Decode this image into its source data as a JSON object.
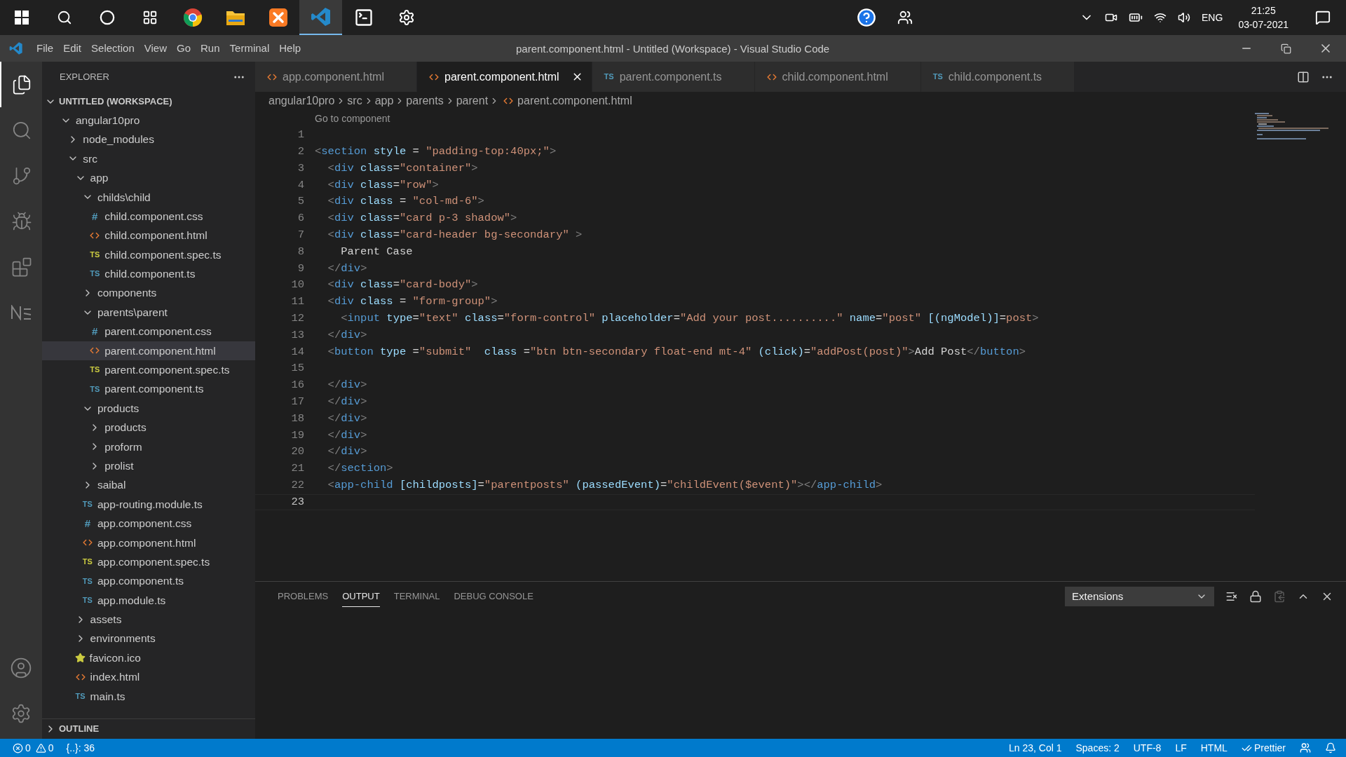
{
  "taskbar": {
    "apps": [
      {
        "kind": "start",
        "selected": false
      },
      {
        "kind": "search",
        "selected": false
      },
      {
        "kind": "circle",
        "selected": false
      },
      {
        "kind": "taskview",
        "selected": false
      },
      {
        "kind": "browser",
        "selected": false
      },
      {
        "kind": "folder",
        "selected": false
      },
      {
        "kind": "xampp",
        "selected": false
      },
      {
        "kind": "editor",
        "selected": true
      },
      {
        "kind": "terminal",
        "selected": false
      },
      {
        "kind": "settings",
        "selected": false
      }
    ],
    "language": "ENG",
    "time": "21:25",
    "date": "03-07-2021"
  },
  "menu": [
    "File",
    "Edit",
    "Selection",
    "View",
    "Go",
    "Run",
    "Terminal",
    "Help"
  ],
  "window": {
    "title": "parent.component.html - Untitled (Workspace) - Visual Studio Code"
  },
  "activity": [
    {
      "kind": "files",
      "selected": true
    },
    {
      "kind": "search",
      "selected": false
    },
    {
      "kind": "git",
      "selected": false
    },
    {
      "kind": "debug",
      "selected": false
    },
    {
      "kind": "extensions",
      "selected": false
    },
    {
      "kind": "notebook",
      "selected": false
    }
  ],
  "explorer": {
    "title": "EXPLORER",
    "workspace": {
      "label": "UNTITLED (WORKSPACE)",
      "expanded": true
    },
    "outline": {
      "label": "OUTLINE",
      "expanded": false
    },
    "tree": [
      {
        "label": "angular10pro",
        "kind": "folder",
        "expanded": true,
        "selected": false,
        "children": [
          {
            "label": "node_modules",
            "kind": "folder",
            "expanded": false,
            "selected": false
          },
          {
            "label": "src",
            "kind": "folder",
            "expanded": true,
            "selected": false,
            "children": [
              {
                "label": "app",
                "kind": "folder",
                "expanded": true,
                "selected": false,
                "children": [
                  {
                    "label": "childs\\child",
                    "kind": "folder",
                    "expanded": true,
                    "selected": false,
                    "children": [
                      {
                        "label": "child.component.css",
                        "kind": "css",
                        "icon": "#",
                        "selected": false
                      },
                      {
                        "label": "child.component.html",
                        "kind": "html",
                        "selected": false
                      },
                      {
                        "label": "child.component.spec.ts",
                        "kind": "spec",
                        "icon": "TS",
                        "selected": false
                      },
                      {
                        "label": "child.component.ts",
                        "kind": "ts",
                        "icon": "TS",
                        "selected": false
                      }
                    ]
                  },
                  {
                    "label": "components",
                    "kind": "folder",
                    "expanded": false,
                    "selected": false
                  },
                  {
                    "label": "parents\\parent",
                    "kind": "folder",
                    "expanded": true,
                    "selected": false,
                    "children": [
                      {
                        "label": "parent.component.css",
                        "kind": "css",
                        "icon": "#",
                        "selected": false
                      },
                      {
                        "label": "parent.component.html",
                        "kind": "html",
                        "selected": true
                      },
                      {
                        "label": "parent.component.spec.ts",
                        "kind": "spec",
                        "icon": "TS",
                        "selected": false
                      },
                      {
                        "label": "parent.component.ts",
                        "kind": "ts",
                        "icon": "TS",
                        "selected": false
                      }
                    ]
                  },
                  {
                    "label": "products",
                    "kind": "folder",
                    "expanded": true,
                    "selected": false,
                    "children": [
                      {
                        "label": "products",
                        "kind": "folder",
                        "expanded": false,
                        "selected": false
                      },
                      {
                        "label": "proform",
                        "kind": "folder",
                        "expanded": false,
                        "selected": false
                      },
                      {
                        "label": "prolist",
                        "kind": "folder",
                        "expanded": false,
                        "selected": false
                      }
                    ]
                  },
                  {
                    "label": "saibal",
                    "kind": "folder",
                    "expanded": false,
                    "selected": false
                  },
                  {
                    "label": "app-routing.module.ts",
                    "kind": "ts",
                    "icon": "TS",
                    "selected": false
                  },
                  {
                    "label": "app.component.css",
                    "kind": "css",
                    "icon": "#",
                    "selected": false
                  },
                  {
                    "label": "app.component.html",
                    "kind": "html",
                    "selected": false
                  },
                  {
                    "label": "app.component.spec.ts",
                    "kind": "spec",
                    "icon": "TS",
                    "selected": false
                  },
                  {
                    "label": "app.component.ts",
                    "kind": "ts",
                    "icon": "TS",
                    "selected": false
                  },
                  {
                    "label": "app.module.ts",
                    "kind": "ts",
                    "icon": "TS",
                    "selected": false
                  }
                ]
              },
              {
                "label": "assets",
                "kind": "folder",
                "expanded": false,
                "selected": false
              },
              {
                "label": "environments",
                "kind": "folder",
                "expanded": false,
                "selected": false
              },
              {
                "label": "favicon.ico",
                "kind": "star",
                "selected": false
              },
              {
                "label": "index.html",
                "kind": "html",
                "selected": false
              },
              {
                "label": "main.ts",
                "kind": "ts",
                "icon": "TS",
                "selected": false
              }
            ]
          }
        ]
      }
    ]
  },
  "tabs": [
    {
      "label": "app.component.html",
      "kind": "html",
      "selected": false
    },
    {
      "label": "parent.component.html",
      "kind": "html",
      "selected": true
    },
    {
      "label": "parent.component.ts",
      "kind": "ts",
      "icon": "TS",
      "selected": false
    },
    {
      "label": "child.component.html",
      "kind": "html",
      "selected": false
    },
    {
      "label": "child.component.ts",
      "kind": "ts",
      "icon": "TS",
      "selected": false
    }
  ],
  "breadcrumb": [
    "angular10pro",
    "src",
    "app",
    "parents",
    "parent",
    "parent.component.html"
  ],
  "codelens": "Go to component",
  "code": {
    "lines": [
      {
        "number": "1",
        "current": false
      },
      {
        "number": "2",
        "current": false,
        "tokens": [
          {
            "kind": "punct",
            "text": "<"
          },
          {
            "kind": "tag",
            "text": "section"
          },
          {
            "kind": "attr",
            "text": " style"
          },
          {
            "kind": "op",
            "text": " = "
          },
          {
            "kind": "str",
            "text": "\"padding-top:40px;\""
          },
          {
            "kind": "punct",
            "text": ">"
          }
        ]
      },
      {
        "number": "3",
        "current": false,
        "tokens": [
          {
            "kind": "punct",
            "text": "  <"
          },
          {
            "kind": "tag",
            "text": "div"
          },
          {
            "kind": "attr",
            "text": " class"
          },
          {
            "kind": "op",
            "text": "="
          },
          {
            "kind": "str",
            "text": "\"container\""
          },
          {
            "kind": "punct",
            "text": ">"
          }
        ]
      },
      {
        "number": "4",
        "current": false,
        "tokens": [
          {
            "kind": "punct",
            "text": "  <"
          },
          {
            "kind": "tag",
            "text": "div"
          },
          {
            "kind": "attr",
            "text": " class"
          },
          {
            "kind": "op",
            "text": "="
          },
          {
            "kind": "str",
            "text": "\"row\""
          },
          {
            "kind": "punct",
            "text": ">"
          }
        ]
      },
      {
        "number": "5",
        "current": false,
        "tokens": [
          {
            "kind": "punct",
            "text": "  <"
          },
          {
            "kind": "tag",
            "text": "div"
          },
          {
            "kind": "attr",
            "text": " class"
          },
          {
            "kind": "op",
            "text": " = "
          },
          {
            "kind": "str",
            "text": "\"col-md-6\""
          },
          {
            "kind": "punct",
            "text": ">"
          }
        ]
      },
      {
        "number": "6",
        "current": false,
        "tokens": [
          {
            "kind": "punct",
            "text": "  <"
          },
          {
            "kind": "tag",
            "text": "div"
          },
          {
            "kind": "attr",
            "text": " class"
          },
          {
            "kind": "op",
            "text": "="
          },
          {
            "kind": "str",
            "text": "\"card p-3 shadow\""
          },
          {
            "kind": "punct",
            "text": ">"
          }
        ]
      },
      {
        "number": "7",
        "current": false,
        "tokens": [
          {
            "kind": "punct",
            "text": "  <"
          },
          {
            "kind": "tag",
            "text": "div"
          },
          {
            "kind": "attr",
            "text": " class"
          },
          {
            "kind": "op",
            "text": "="
          },
          {
            "kind": "str",
            "text": "\"card-header bg-secondary\""
          },
          {
            "kind": "punct",
            "text": " >"
          }
        ]
      },
      {
        "number": "8",
        "current": false,
        "tokens": [
          {
            "kind": "op",
            "text": "    Parent Case"
          }
        ]
      },
      {
        "number": "9",
        "current": false,
        "tokens": [
          {
            "kind": "punct",
            "text": "  </"
          },
          {
            "kind": "tag",
            "text": "div"
          },
          {
            "kind": "punct",
            "text": ">"
          }
        ]
      },
      {
        "number": "10",
        "current": false,
        "tokens": [
          {
            "kind": "punct",
            "text": "  <"
          },
          {
            "kind": "tag",
            "text": "div"
          },
          {
            "kind": "attr",
            "text": " class"
          },
          {
            "kind": "op",
            "text": "="
          },
          {
            "kind": "str",
            "text": "\"card-body\""
          },
          {
            "kind": "punct",
            "text": ">"
          }
        ]
      },
      {
        "number": "11",
        "current": false,
        "tokens": [
          {
            "kind": "punct",
            "text": "  <"
          },
          {
            "kind": "tag",
            "text": "div"
          },
          {
            "kind": "attr",
            "text": " class"
          },
          {
            "kind": "op",
            "text": " = "
          },
          {
            "kind": "str",
            "text": "\"form-group\""
          },
          {
            "kind": "punct",
            "text": ">"
          }
        ]
      },
      {
        "number": "12",
        "current": false,
        "tokens": [
          {
            "kind": "punct",
            "text": "    <"
          },
          {
            "kind": "tag",
            "text": "input"
          },
          {
            "kind": "attr",
            "text": " type"
          },
          {
            "kind": "op",
            "text": "="
          },
          {
            "kind": "str",
            "text": "\"text\""
          },
          {
            "kind": "attr",
            "text": " class"
          },
          {
            "kind": "op",
            "text": "="
          },
          {
            "kind": "str",
            "text": "\"form-control\""
          },
          {
            "kind": "attr",
            "text": " placeholder"
          },
          {
            "kind": "op",
            "text": "="
          },
          {
            "kind": "str",
            "text": "\"Add your post..........\""
          },
          {
            "kind": "attr",
            "text": " name"
          },
          {
            "kind": "op",
            "text": "="
          },
          {
            "kind": "str",
            "text": "\"post\""
          },
          {
            "kind": "attr",
            "text": " [(ngModel)]"
          },
          {
            "kind": "op",
            "text": "="
          },
          {
            "kind": "str",
            "text": "post"
          },
          {
            "kind": "punct",
            "text": ">"
          }
        ]
      },
      {
        "number": "13",
        "current": false,
        "tokens": [
          {
            "kind": "punct",
            "text": "  </"
          },
          {
            "kind": "tag",
            "text": "div"
          },
          {
            "kind": "punct",
            "text": ">"
          }
        ]
      },
      {
        "number": "14",
        "current": false,
        "tokens": [
          {
            "kind": "punct",
            "text": "  <"
          },
          {
            "kind": "tag",
            "text": "button"
          },
          {
            "kind": "attr",
            "text": " type"
          },
          {
            "kind": "op",
            "text": " ="
          },
          {
            "kind": "str",
            "text": "\"submit\""
          },
          {
            "kind": "attr",
            "text": "  class"
          },
          {
            "kind": "op",
            "text": " ="
          },
          {
            "kind": "str",
            "text": "\"btn btn-secondary float-end mt-4\""
          },
          {
            "kind": "attr",
            "text": " (click)"
          },
          {
            "kind": "op",
            "text": "="
          },
          {
            "kind": "str",
            "text": "\"addPost(post)\""
          },
          {
            "kind": "punct",
            "text": ">"
          },
          {
            "kind": "op",
            "text": "Add Post"
          },
          {
            "kind": "punct",
            "text": "</"
          },
          {
            "kind": "tag",
            "text": "button"
          },
          {
            "kind": "punct",
            "text": ">"
          }
        ]
      },
      {
        "number": "15",
        "current": false
      },
      {
        "number": "16",
        "current": false,
        "tokens": [
          {
            "kind": "punct",
            "text": "  </"
          },
          {
            "kind": "tag",
            "text": "div"
          },
          {
            "kind": "punct",
            "text": ">"
          }
        ]
      },
      {
        "number": "17",
        "current": false,
        "tokens": [
          {
            "kind": "punct",
            "text": "  </"
          },
          {
            "kind": "tag",
            "text": "div"
          },
          {
            "kind": "punct",
            "text": ">"
          }
        ]
      },
      {
        "number": "18",
        "current": false,
        "tokens": [
          {
            "kind": "punct",
            "text": "  </"
          },
          {
            "kind": "tag",
            "text": "div"
          },
          {
            "kind": "punct",
            "text": ">"
          }
        ]
      },
      {
        "number": "19",
        "current": false,
        "tokens": [
          {
            "kind": "punct",
            "text": "  </"
          },
          {
            "kind": "tag",
            "text": "div"
          },
          {
            "kind": "punct",
            "text": ">"
          }
        ]
      },
      {
        "number": "20",
        "current": false,
        "tokens": [
          {
            "kind": "punct",
            "text": "  </"
          },
          {
            "kind": "tag",
            "text": "div"
          },
          {
            "kind": "punct",
            "text": ">"
          }
        ]
      },
      {
        "number": "21",
        "current": false,
        "tokens": [
          {
            "kind": "punct",
            "text": "  </"
          },
          {
            "kind": "tag",
            "text": "section"
          },
          {
            "kind": "punct",
            "text": ">"
          }
        ]
      },
      {
        "number": "22",
        "current": false,
        "tokens": [
          {
            "kind": "punct",
            "text": "  <"
          },
          {
            "kind": "tag",
            "text": "app-child"
          },
          {
            "kind": "attr",
            "text": " [childposts]"
          },
          {
            "kind": "op",
            "text": "="
          },
          {
            "kind": "str",
            "text": "\"parentposts\""
          },
          {
            "kind": "attr",
            "text": " (passedEvent)"
          },
          {
            "kind": "op",
            "text": "="
          },
          {
            "kind": "str",
            "text": "\"childEvent($event)\""
          },
          {
            "kind": "punct",
            "text": "></"
          },
          {
            "kind": "tag",
            "text": "app-child"
          },
          {
            "kind": "punct",
            "text": ">"
          }
        ]
      },
      {
        "number": "23",
        "current": true
      }
    ]
  },
  "panel": {
    "tabs": [
      {
        "label": "PROBLEMS",
        "selected": false
      },
      {
        "label": "OUTPUT",
        "selected": true
      },
      {
        "label": "TERMINAL",
        "selected": false
      },
      {
        "label": "DEBUG CONSOLE",
        "selected": false
      }
    ],
    "channel": "Extensions"
  },
  "status_bar": {
    "errors": "0",
    "warnings": "0",
    "symbols": "{..}: 36",
    "position": "Ln 23, Col 1",
    "spaces": "Spaces: 2",
    "encoding": "UTF-8",
    "eol": "LF",
    "language": "HTML",
    "formatter": "Prettier"
  }
}
